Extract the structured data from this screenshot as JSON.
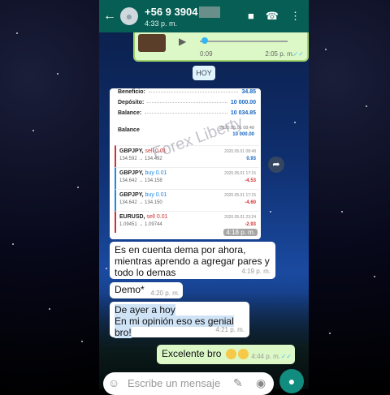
{
  "header": {
    "contact_name": "+56 9 3904",
    "status": "4:33 p. m.",
    "icons": [
      "back-arrow-icon",
      "video-call-icon",
      "phone-icon",
      "more-options-icon"
    ]
  },
  "voice_note": {
    "duration": "0:09",
    "time": "2:05 p. m.",
    "ticks": "✓✓"
  },
  "day_separator": "HOY",
  "screenshot_message": {
    "time": "4:18 p. m.",
    "watermark": "Forex Liberty",
    "account": [
      {
        "key": "Beneficio:",
        "value": "34.85"
      },
      {
        "key": "Depósito:",
        "value": "10 000.00"
      },
      {
        "key": "Balance:",
        "value": "10 034.85"
      }
    ],
    "balance_row": {
      "label": "Balance",
      "date": "2020.05.01 08:48",
      "value": "10 000.00"
    },
    "trades": [
      {
        "pair": "GBPJPY,",
        "side": "sell 0.01",
        "side_type": "sell",
        "prices": "134.592 → 134.492",
        "date": "2020.05.01 08:48",
        "profit": "0.93",
        "profit_sign": "pos"
      },
      {
        "pair": "GBPJPY,",
        "side": "buy 0.01",
        "side_type": "buy",
        "prices": "134.642 → 134.158",
        "date": "2020.05.01 17:15",
        "profit": "-4.53",
        "profit_sign": "neg"
      },
      {
        "pair": "GBPJPY,",
        "side": "buy 0.01",
        "side_type": "buy",
        "prices": "134.642 → 134.150",
        "date": "2020.05.01 17:15",
        "profit": "-4.60",
        "profit_sign": "neg"
      },
      {
        "pair": "EURUSD,",
        "side": "sell 0.01",
        "side_type": "sell",
        "prices": "1.09451 → 1.09744",
        "date": "2020.05.01 23:24",
        "profit": "-2.93",
        "profit_sign": "neg"
      }
    ]
  },
  "messages": [
    {
      "text_lines": [
        "Es en cuenta dema   por ahora,",
        "mientras aprendo a agregar pares y",
        "todo  lo demas"
      ],
      "time": "4:19 p. m.",
      "direction": "in"
    },
    {
      "text_lines": [
        "Demo*"
      ],
      "time": "4:20 p. m.",
      "direction": "in"
    },
    {
      "text_lines": [
        "De ayer a hoy",
        "En mi opinión eso es genial bro!"
      ],
      "time": "4:21 p. m.",
      "direction": "in"
    },
    {
      "text_lines": [
        "Excelente bro"
      ],
      "time": "4:44 p. m.",
      "direction": "out",
      "ticks": "✓✓"
    }
  ],
  "composer": {
    "placeholder": "Escribe un mensaje"
  },
  "colors": {
    "header": "#075e54",
    "outgoing_bubble": "#dcf8c6",
    "incoming_bubble": "#ffffff",
    "mic_button": "#128c7e",
    "read_ticks": "#4fc3f7"
  }
}
